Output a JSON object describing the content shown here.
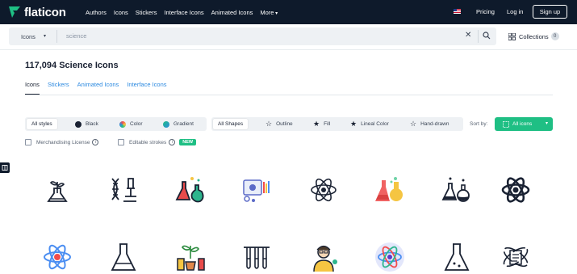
{
  "header": {
    "logo_text": "flaticon",
    "nav": [
      "Authors",
      "Icons",
      "Stickers",
      "Interface Icons",
      "Animated Icons",
      "More"
    ],
    "pricing": "Pricing",
    "login": "Log in",
    "signup": "Sign up"
  },
  "search": {
    "category": "Icons",
    "placeholder": "science",
    "collections_label": "Collections",
    "collections_count": "0"
  },
  "page": {
    "title": "117,094 Science Icons",
    "tabs": [
      "Icons",
      "Stickers",
      "Animated Icons",
      "Interface Icons"
    ],
    "active_tab": "Icons"
  },
  "filters": {
    "styles": [
      "All styles",
      "Black",
      "Color",
      "Gradient"
    ],
    "shapes": [
      "All Shapes",
      "Outline",
      "Fill",
      "Lineal Color",
      "Hand-drawn"
    ],
    "sort_label": "Sort by:",
    "sort_value": "All icons",
    "merchandising": "Merchandising License",
    "editable": "Editable strokes",
    "new_badge": "NEW"
  },
  "colors": {
    "nav_bg": "#0e1a2b",
    "accent_green": "#1fbf84",
    "link_blue": "#2d8ae0",
    "filter_bg": "#eef1f4"
  },
  "icons": [
    "plant-flask-icon",
    "dna-microscope-icon",
    "colored-flasks-icon",
    "lab-equipment-icon",
    "atom-outline-icon",
    "red-yellow-flasks-icon",
    "flask-bubbles-icon",
    "atom-filled-icon",
    "blue-atom-icon",
    "conical-flask-icon",
    "plant-lab-icon",
    "test-tubes-icon",
    "scientist-icon",
    "atom-circle-icon",
    "flask-outline-icon",
    "atom-document-icon"
  ]
}
